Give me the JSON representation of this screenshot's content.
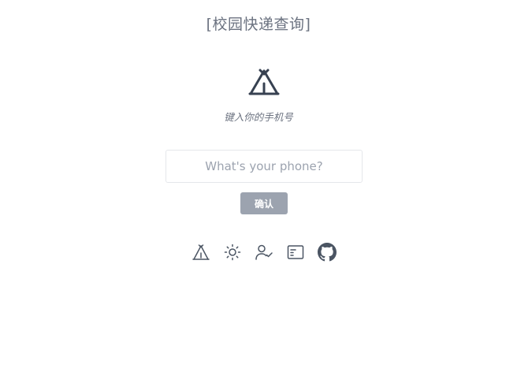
{
  "app": {
    "title": "[校园快递查询]",
    "subtitle": "键入你的手机号"
  },
  "form": {
    "phone_placeholder": "What's your phone?",
    "phone_value": "",
    "confirm_label": "确认"
  },
  "footer": {
    "icons": [
      "tent-icon",
      "sun-icon",
      "user-check-icon",
      "card-icon",
      "github-icon"
    ]
  },
  "colors": {
    "text_muted": "#6b7280",
    "icon_dark": "#374151",
    "button_bg": "#9ca3af",
    "input_border": "#e5e7eb"
  }
}
